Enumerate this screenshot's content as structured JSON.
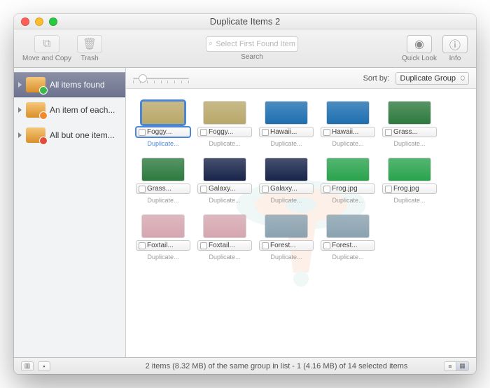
{
  "window": {
    "title": "Duplicate Items 2"
  },
  "toolbar": {
    "move_copy_label": "Move and Copy",
    "trash_label": "Trash",
    "search_placeholder": "Select First Found Item",
    "search_label": "Search",
    "quicklook_label": "Quick Look",
    "info_label": "Info"
  },
  "sidebar": {
    "items": [
      {
        "label": "All items found",
        "selected": true
      },
      {
        "label": "An item of each...",
        "selected": false
      },
      {
        "label": "All but one item...",
        "selected": false
      }
    ]
  },
  "sort": {
    "label": "Sort by:",
    "value": "Duplicate Group"
  },
  "grid": {
    "items": [
      {
        "name": "Foggy...",
        "sub": "Duplicate...",
        "color": "#b9a86a",
        "selected": true
      },
      {
        "name": "Foggy...",
        "sub": "Duplicate...",
        "color": "#b9a86a"
      },
      {
        "name": "Hawaii...",
        "sub": "Duplicate...",
        "color": "#1e6fb0"
      },
      {
        "name": "Hawaii...",
        "sub": "Duplicate...",
        "color": "#1e6fb0"
      },
      {
        "name": "Grass...",
        "sub": "Duplicate...",
        "color": "#2d7a3e"
      },
      {
        "name": "Grass...",
        "sub": "Duplicate...",
        "color": "#2d7a3e"
      },
      {
        "name": "Galaxy...",
        "sub": "Duplicate...",
        "color": "#18244a"
      },
      {
        "name": "Galaxy...",
        "sub": "Duplicate...",
        "color": "#18244a"
      },
      {
        "name": "Frog.jpg",
        "sub": "Duplicate...",
        "color": "#2aa34d"
      },
      {
        "name": "Frog.jpg",
        "sub": "Duplicate...",
        "color": "#2aa34d"
      },
      {
        "name": "Foxtail...",
        "sub": "Duplicate...",
        "color": "#d6a6b0"
      },
      {
        "name": "Foxtail...",
        "sub": "Duplicate...",
        "color": "#d6a6b0"
      },
      {
        "name": "Forest...",
        "sub": "Duplicate...",
        "color": "#8aa2b0"
      },
      {
        "name": "Forest...",
        "sub": "Duplicate...",
        "color": "#8aa2b0"
      }
    ]
  },
  "status": {
    "text": "2 items (8.32 MB) of the same group in list - 1 (4.16 MB) of 14 selected items"
  }
}
